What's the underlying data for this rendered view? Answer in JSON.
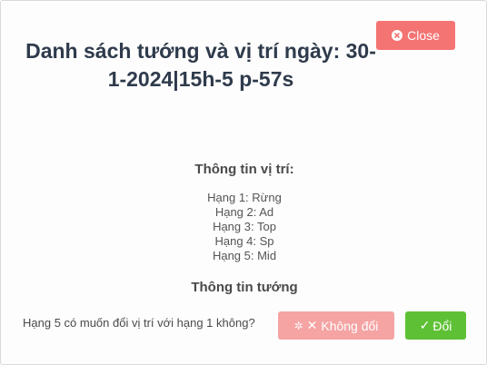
{
  "dialog": {
    "title": "Danh sách tướng và vị trí ngày: 30-1-2024|15h-5 p-57s",
    "close_label": "Close",
    "position_info_heading": "Thông tin vị trí:",
    "positions": [
      "Hạng 1: Rừng",
      "Hạng 2: Ad",
      "Hạng 3: Top",
      "Hạng 4: Sp",
      "Hạng 5: Mid"
    ],
    "champion_info_heading": "Thông tin tướng",
    "question": "Hạng 5 có muốn đổi vị trí với hạng 1 không?",
    "no_change_label": "Không đổi",
    "change_label": "Đổi"
  },
  "icons": {
    "close": "circle-x-icon",
    "spinner": "spinner-icon",
    "x": "x-icon",
    "check": "check-icon"
  },
  "colors": {
    "close_button": "#f47373",
    "no_change_button": "#f5a3a3",
    "change_button": "#5ec135",
    "title_text": "#2f3b4c"
  }
}
